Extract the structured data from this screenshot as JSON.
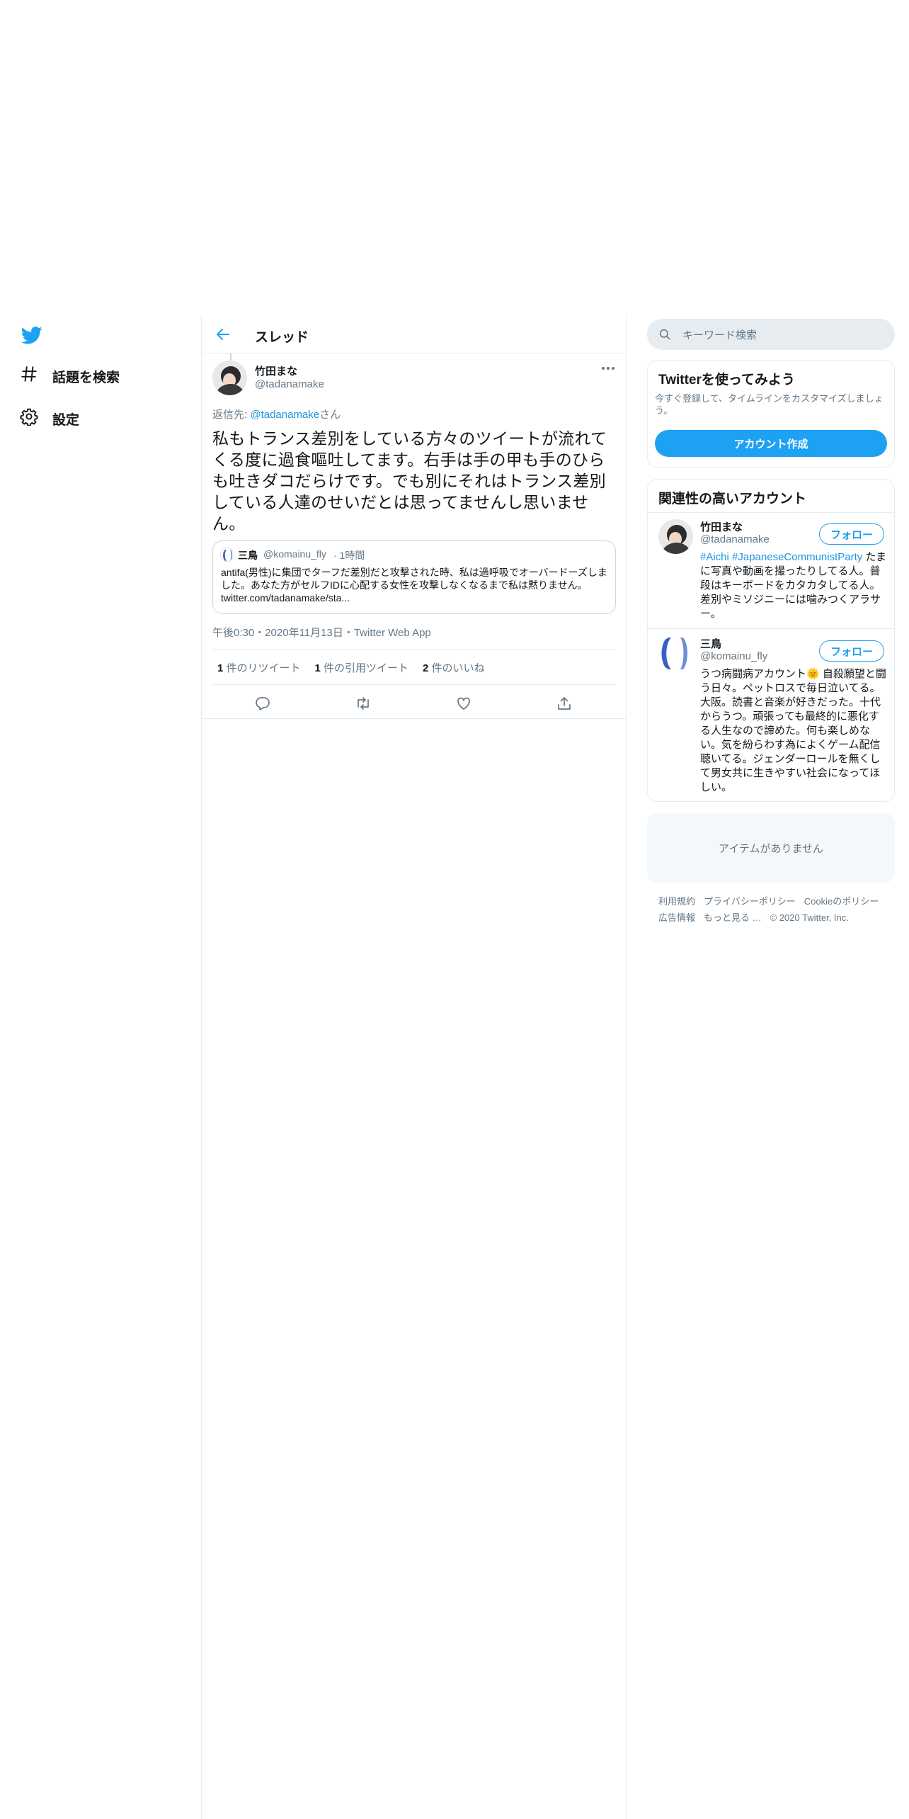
{
  "nav": {
    "logo_icon": "twitter-bird-icon",
    "items": [
      {
        "icon": "hashtag-icon",
        "label": "話題を検索"
      },
      {
        "icon": "gear-icon",
        "label": "設定"
      }
    ]
  },
  "header": {
    "title": "スレッド",
    "back_icon": "arrow-left-icon"
  },
  "tweet": {
    "author_name": "竹田まな",
    "author_handle": "@tadanamake",
    "more_icon": "more-icon",
    "reply_prefix": "返信先: ",
    "reply_link": "@tadanamake",
    "reply_suffix": "さん",
    "text": "私もトランス差別をしている方々のツイートが流れてくる度に過食嘔吐してます。右手は手の甲も手のひらも吐きダコだらけです。でも別にそれはトランス差別している人達のせいだとは思ってませんし思いません。",
    "quote": {
      "author_name": "三鳥",
      "author_handle": "@komainu_fly",
      "time": "· 1時間",
      "text": "antifa(男性)に集団でターフだ差別だと攻撃された時、私は過呼吸でオーバードーズしました。あなた方がセルフIDに心配する女性を攻撃しなくなるまで私は黙りません。 twitter.com/tadanamake/sta..."
    },
    "timestamp": "午後0:30・2020年11月13日・Twitter Web App",
    "stats": {
      "retweets_count": "1",
      "retweets_label": " 件のリツイート",
      "quotes_count": "1",
      "quotes_label": " 件の引用ツイート",
      "likes_count": "2",
      "likes_label": " 件のいいね"
    },
    "actions": [
      "reply-icon",
      "retweet-icon",
      "like-icon",
      "share-icon"
    ]
  },
  "sidebar": {
    "search_placeholder": "キーワード検索",
    "signup_card": {
      "title": "Twitterを使ってみよう",
      "subtitle": "今すぐ登録して、タイムラインをカスタマイズしましょう。",
      "button": "アカウント作成"
    },
    "related": {
      "title": "関連性の高いアカウント",
      "accounts": [
        {
          "name": "竹田まな",
          "handle": "@tadanamake",
          "follow": "フォロー",
          "bio_hashtags": "#Aichi #JapaneseCommunistParty",
          "bio": " たまに写真や動画を撮ったりしてる人。普段はキーボードをカタカタしてる人。差別やミソジニーには噛みつくアラサー。"
        },
        {
          "name": "三鳥",
          "handle": "@komainu_fly",
          "follow": "フォロー",
          "bio": "うつ病闘病アカウント🌞 自殺願望と闘う日々。ペットロスで毎日泣いてる。大阪。読書と音楽が好きだった。十代からうつ。頑張っても最終的に悪化する人生なので諦めた。何も楽しめない。気を紛らわす為によくゲーム配信聴いてる。ジェンダーロールを無くして男女共に生きやすい社会になってほしい。"
        }
      ]
    },
    "empty_message": "アイテムがありません",
    "footer": {
      "links": [
        "利用規約",
        "プライバシーポリシー",
        "Cookieのポリシー",
        "広告情報",
        "もっと見る …"
      ],
      "copyright": "© 2020 Twitter, Inc."
    }
  },
  "colors": {
    "accent": "#1da1f2",
    "link": "#1b95e0",
    "border": "#e6ecf0",
    "muted": "#657786"
  }
}
